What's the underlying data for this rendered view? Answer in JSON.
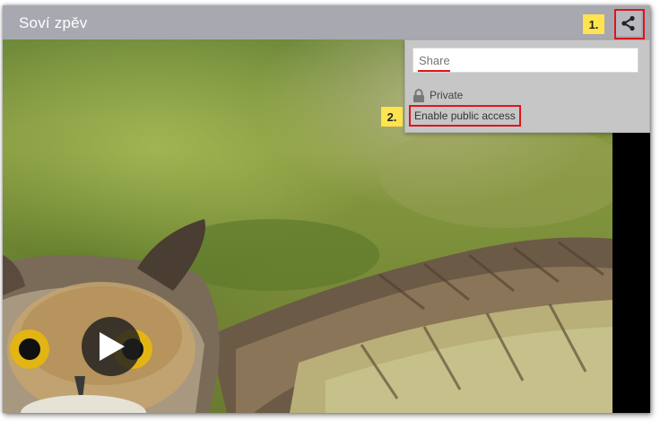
{
  "window": {
    "title": "Soví zpěv"
  },
  "toolbar": {
    "share_icon": "share-icon"
  },
  "annotations": {
    "step1": "1.",
    "step2": "2."
  },
  "share_menu": {
    "input_placeholder": "Share",
    "privacy_status": "Private",
    "privacy_icon": "lock-icon",
    "enable_public_label": "Enable public access"
  },
  "player": {
    "play_icon": "play-icon"
  },
  "colors": {
    "titlebar": "#a8a8b0",
    "highlight": "#e0141b",
    "badge": "#ffe34f",
    "menu_bg": "#c6c6c6"
  }
}
